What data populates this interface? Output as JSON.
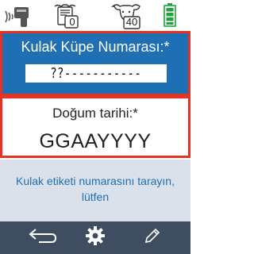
{
  "status_bar": {
    "icons": [
      "scanner-signal-icon",
      "cattle-records-icon",
      "cattle-count-icon",
      "battery-icon"
    ],
    "records_count": "0",
    "cattle_count": "40",
    "battery_level": 0.9
  },
  "eartag": {
    "label": "Kulak Küpe Numarası:*",
    "value": "??-----------"
  },
  "birth_date": {
    "label": "Doğum tarihi:*",
    "format": "GGAAYYYY"
  },
  "hint": {
    "text": "Kulak etiketi numarasını tarayın, lütfen"
  },
  "bottom_bar": {
    "buttons": [
      "back-icon",
      "settings-icon",
      "edit-icon"
    ]
  },
  "colors": {
    "accent_blue": "#1f6fb4",
    "highlight_red": "#e53222",
    "bar_dark": "#3e4d5f",
    "hint_bg": "#dbe1ea",
    "battery_green": "#1fa53a"
  }
}
